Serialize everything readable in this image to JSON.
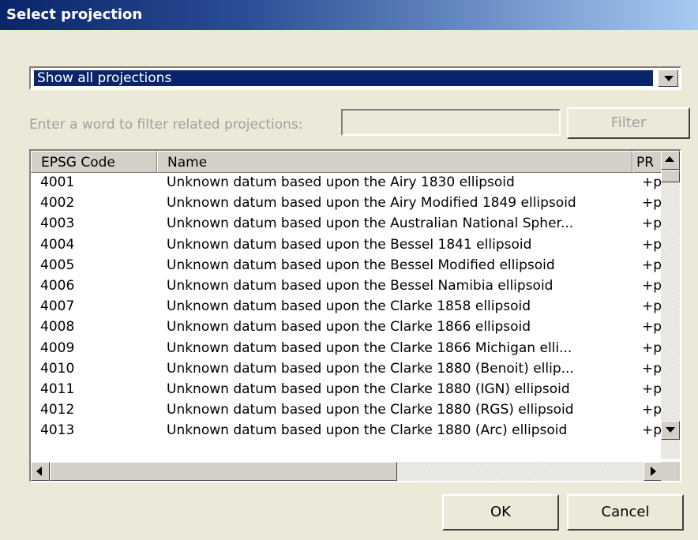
{
  "window": {
    "title": "Select projection"
  },
  "projection_filter": {
    "selected": "Show all projections"
  },
  "filter": {
    "label": "Enter a word to filter related projections:",
    "value": "",
    "button_label": "Filter"
  },
  "table": {
    "columns": [
      "EPSG Code",
      "Name",
      "PR"
    ],
    "rows": [
      {
        "code": "4001",
        "name": "Unknown datum based upon the Airy 1830 ellipsoid",
        "proj": "+p"
      },
      {
        "code": "4002",
        "name": "Unknown datum based upon the Airy Modified 1849 ellipsoid",
        "proj": "+p"
      },
      {
        "code": "4003",
        "name": "Unknown datum based upon the Australian National Spher...",
        "proj": "+p"
      },
      {
        "code": "4004",
        "name": "Unknown datum based upon the Bessel 1841 ellipsoid",
        "proj": "+p"
      },
      {
        "code": "4005",
        "name": "Unknown datum based upon the Bessel Modified ellipsoid",
        "proj": "+p"
      },
      {
        "code": "4006",
        "name": "Unknown datum based upon the Bessel Namibia ellipsoid",
        "proj": "+p"
      },
      {
        "code": "4007",
        "name": "Unknown datum based upon the Clarke 1858 ellipsoid",
        "proj": "+p"
      },
      {
        "code": "4008",
        "name": "Unknown datum based upon the Clarke 1866 ellipsoid",
        "proj": "+p"
      },
      {
        "code": "4009",
        "name": "Unknown datum based upon the Clarke 1866 Michigan elli...",
        "proj": "+p"
      },
      {
        "code": "4010",
        "name": "Unknown datum based upon the Clarke 1880 (Benoit) ellip...",
        "proj": "+p"
      },
      {
        "code": "4011",
        "name": "Unknown datum based upon the Clarke 1880 (IGN) ellipsoid",
        "proj": "+p"
      },
      {
        "code": "4012",
        "name": "Unknown datum based upon the Clarke 1880 (RGS) ellipsoid",
        "proj": "+p"
      },
      {
        "code": "4013",
        "name": "Unknown datum based upon the Clarke 1880 (Arc) ellipsoid",
        "proj": "+p"
      }
    ]
  },
  "buttons": {
    "ok": "OK",
    "cancel": "Cancel"
  }
}
